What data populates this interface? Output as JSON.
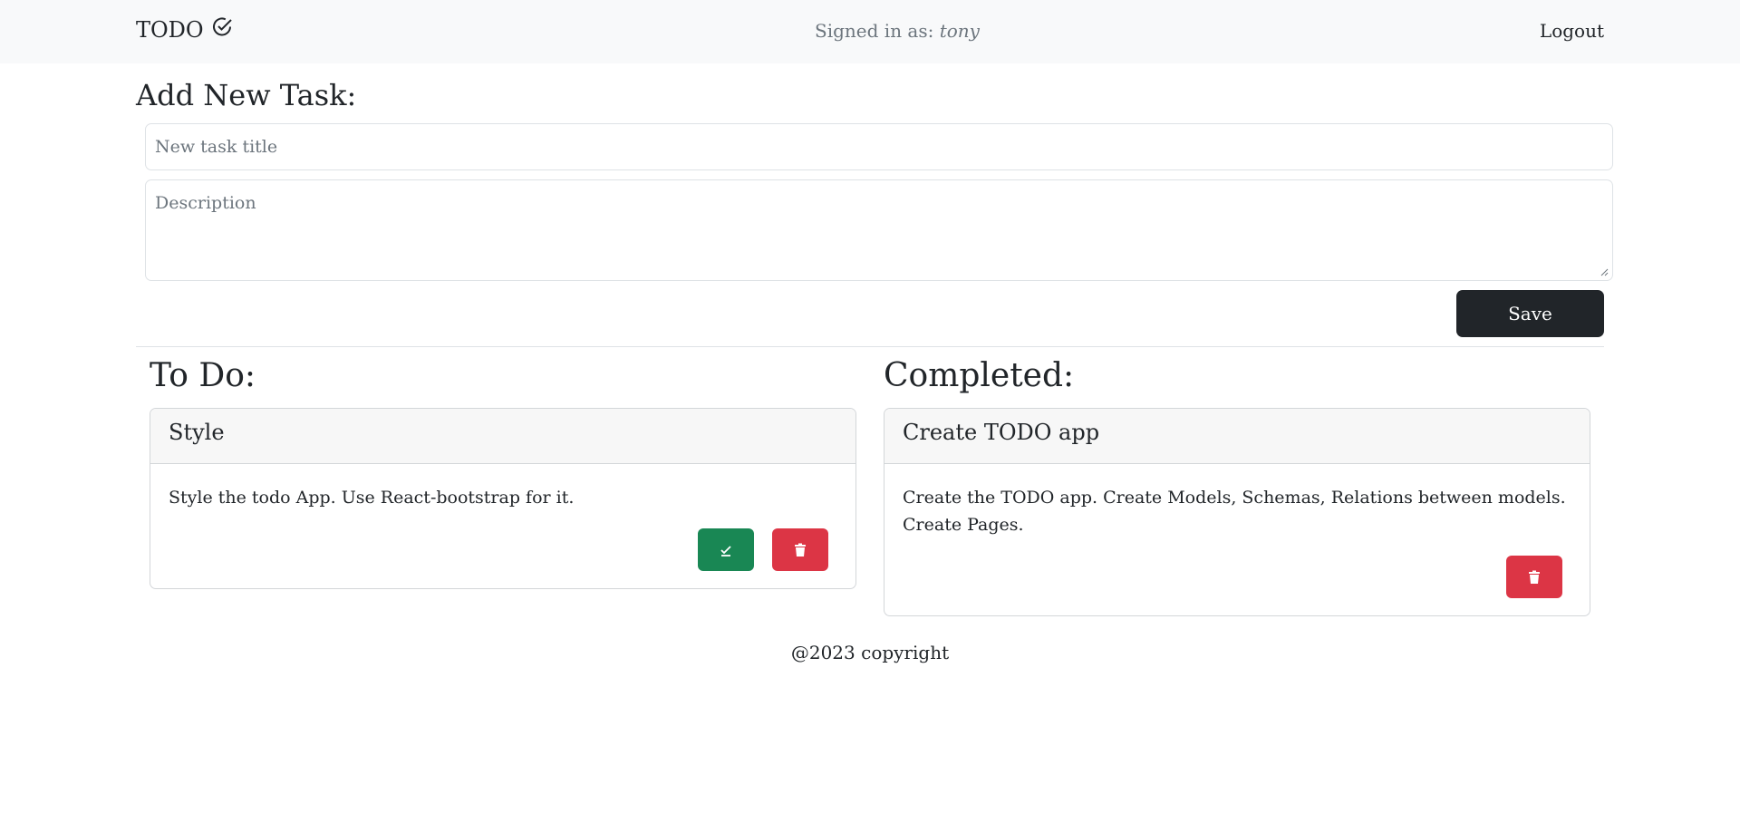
{
  "navbar": {
    "brand": "TODO",
    "signed_in_label": "Signed in as:",
    "username": "tony",
    "logout_label": "Logout"
  },
  "add_task": {
    "heading": "Add New Task:",
    "title_placeholder": "New task title",
    "description_placeholder": "Description",
    "save_label": "Save"
  },
  "todo": {
    "heading": "To Do:",
    "tasks": [
      {
        "title": "Style",
        "description": "Style the todo App. Use React-bootstrap for it."
      }
    ]
  },
  "completed": {
    "heading": "Completed:",
    "tasks": [
      {
        "title": "Create TODO app",
        "description": "Create the TODO app. Create Models, Schemas, Relations between models. Create Pages."
      }
    ]
  },
  "footer": {
    "text": "@2023 copyright"
  },
  "colors": {
    "navbar_bg": "#f8f9fa",
    "save_button": "#212529",
    "complete_button": "#198754",
    "delete_button": "#dc3545"
  },
  "icons": [
    "check-circle-icon",
    "check-icon",
    "trash-icon",
    "resize-handle-icon"
  ]
}
